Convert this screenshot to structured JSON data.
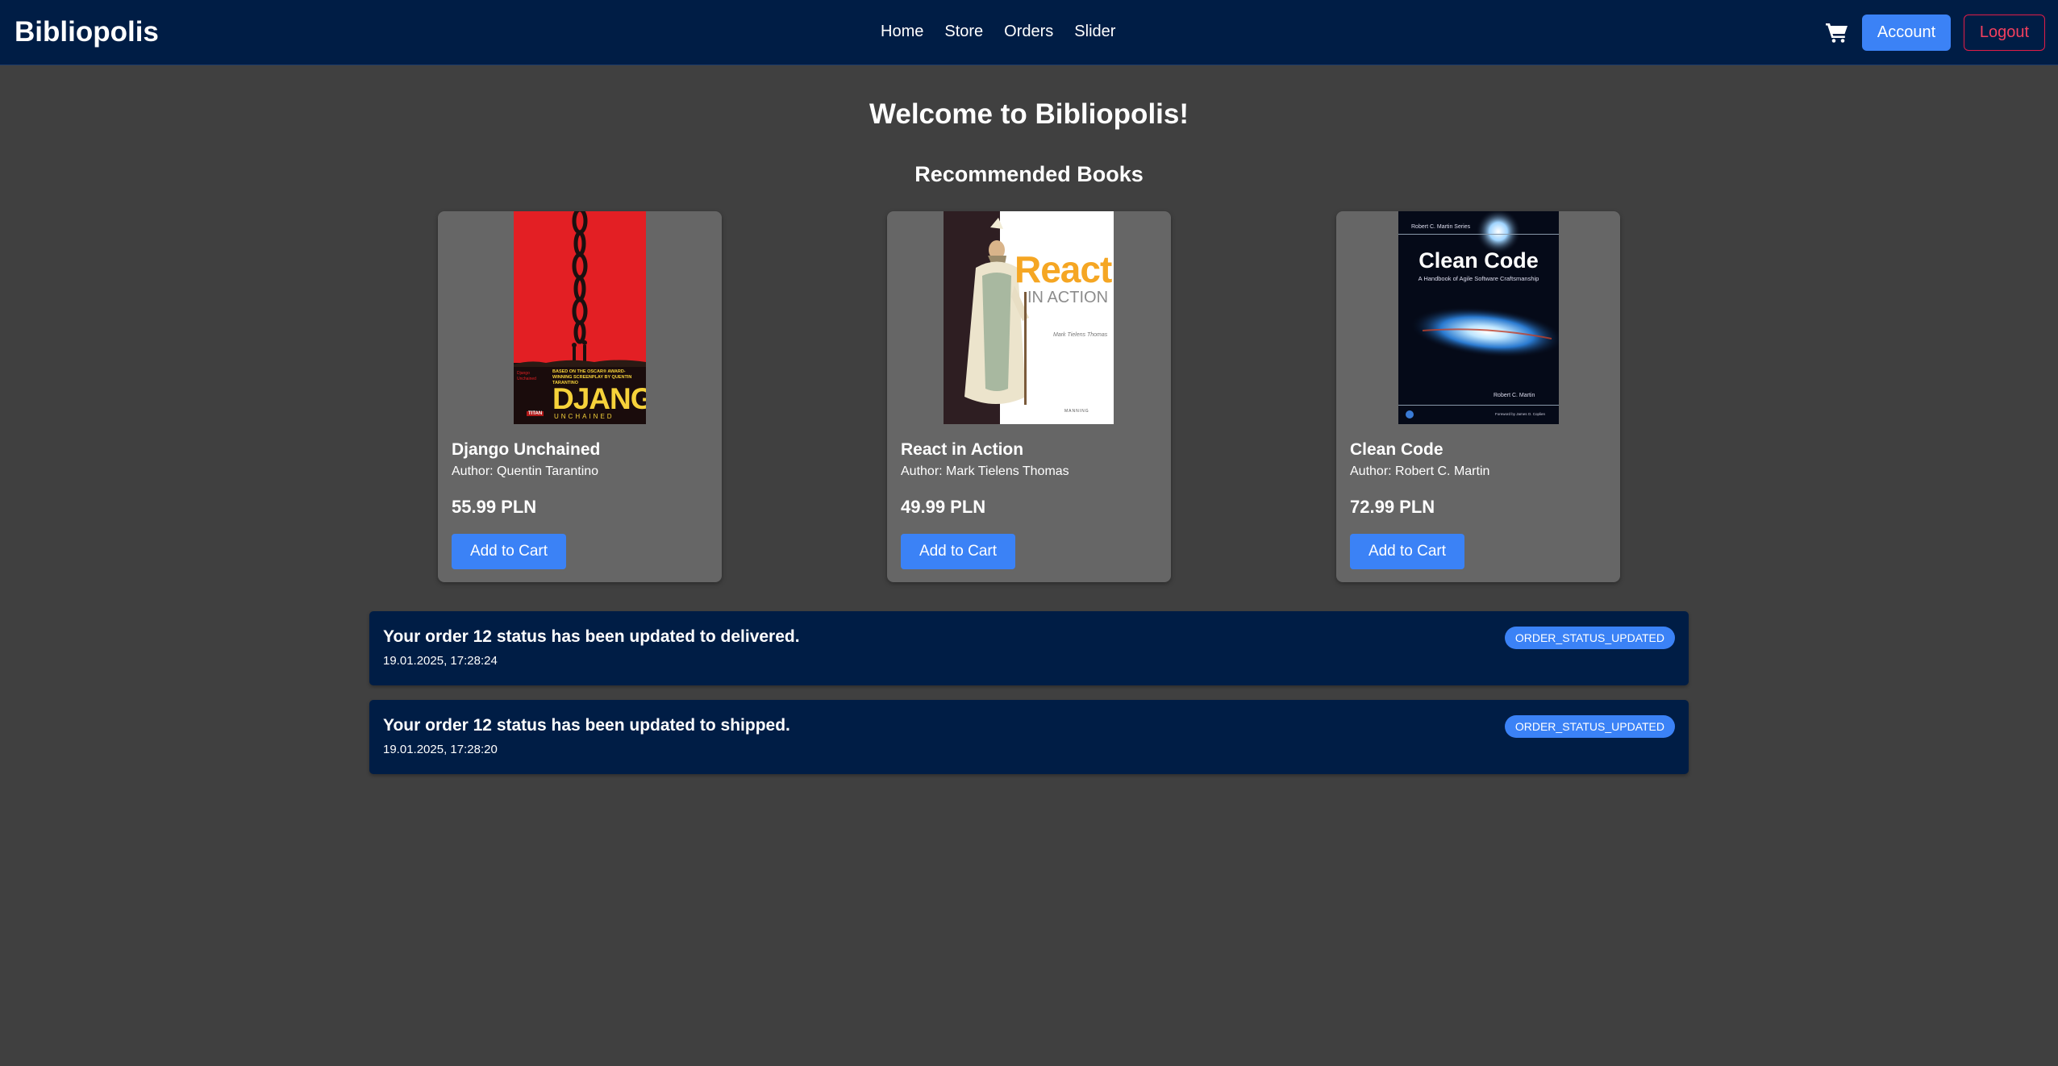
{
  "navbar": {
    "brand": "Bibliopolis",
    "links": [
      "Home",
      "Store",
      "Orders",
      "Slider"
    ],
    "cart_icon": "shopping-cart-icon",
    "account_label": "Account",
    "logout_label": "Logout"
  },
  "main": {
    "welcome": "Welcome to Bibliopolis!",
    "recommended_title": "Recommended Books"
  },
  "books": [
    {
      "title": "Django Unchained",
      "author": "Author: Quentin Tarantino",
      "price": "55.99 PLN",
      "button": "Add to Cart",
      "cover": {
        "credits": "Django Unchained",
        "tagline": "BASED ON THE OSCAR® AWARD-WINNING SCREENPLAY BY QUENTIN TARANTINO",
        "title": "DJANGO",
        "subtitle": "UNCHAINED",
        "publisher": "TITAN"
      }
    },
    {
      "title": "React in Action",
      "author": "Author: Mark Tielens Thomas",
      "price": "49.99 PLN",
      "button": "Add to Cart",
      "cover": {
        "title_top": "React",
        "title_bottom": "IN ACTION",
        "author": "Mark Tielens Thomas",
        "publisher": "MANNING"
      }
    },
    {
      "title": "Clean Code",
      "author": "Author: Robert C. Martin",
      "price": "72.99 PLN",
      "button": "Add to Cart",
      "cover": {
        "series": "Robert C. Martin Series",
        "title": "Clean Code",
        "subtitle": "A Handbook of Agile Software Craftsmanship",
        "author": "Robert C. Martin",
        "foreword": "Foreword by James O. Coplien"
      }
    }
  ],
  "notifications": [
    {
      "message": "Your order 12 status has been updated to delivered.",
      "time": "19.01.2025, 17:28:24",
      "badge": "ORDER_STATUS_UPDATED"
    },
    {
      "message": "Your order 12 status has been updated to shipped.",
      "time": "19.01.2025, 17:28:20",
      "badge": "ORDER_STATUS_UPDATED"
    }
  ],
  "colors": {
    "navbar_bg": "#001d45",
    "page_bg": "#404040",
    "card_bg": "#666666",
    "accent": "#3b82f6",
    "logout": "#f43f5e"
  }
}
